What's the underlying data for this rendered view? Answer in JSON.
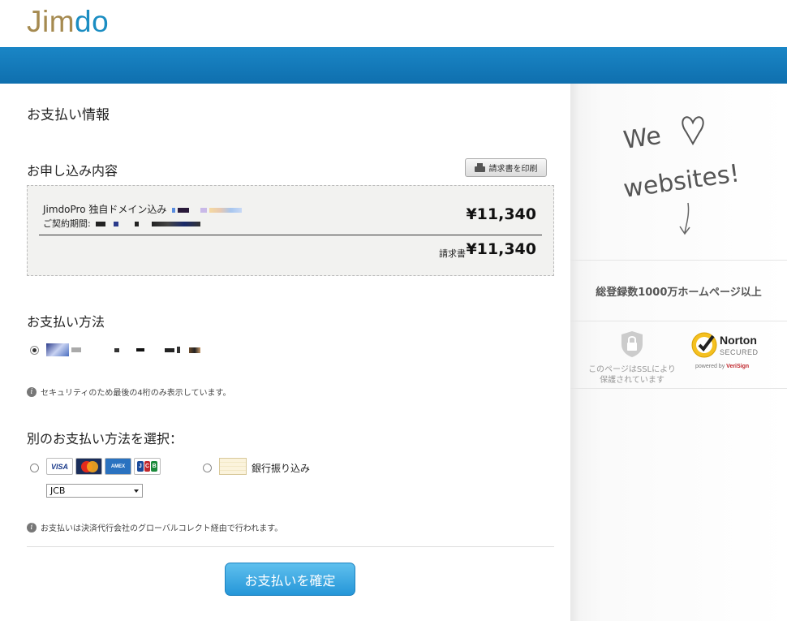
{
  "header": {
    "logo_part1": "Jim",
    "logo_part2": "do"
  },
  "payment_info": {
    "title": "お支払い情報"
  },
  "order": {
    "section_title": "お申し込み内容",
    "print_button": "請求書を印刷",
    "item_name": "JimdoPro 独自ドメイン込み",
    "item_period_label": "ご契約期間:",
    "item_price": "¥11,340",
    "total_label": "請求書",
    "total_price": "¥11,340"
  },
  "payment_method": {
    "section_title": "お支払い方法",
    "security_note": "セキュリティのため最後の4桁のみ表示しています。"
  },
  "alt_payment": {
    "section_title": "別のお支払い方法を選択：",
    "cards": [
      "VISA",
      "MasterCard",
      "AMERICAN EXPRESS",
      "JCB"
    ],
    "selected_card": "JCB",
    "bank_transfer_label": "銀行振り込み",
    "note": "お支払いは決済代行会社のグローバルコレクト経由で行われます。"
  },
  "confirm_button": "お支払いを確定",
  "sidebar": {
    "tagline_line1": "We",
    "tagline_line2": "websites!",
    "stat": "総登録数1000万ホームページ以上",
    "ssl_text_line1": "このページはSSLにより",
    "ssl_text_line2": "保護されています",
    "norton_name": "Norton",
    "norton_secured": "SECURED",
    "norton_powered": "powered by",
    "norton_verisign": "VeriSign"
  },
  "colors": {
    "brand_blue": "#1b8dc2",
    "brand_gold": "#a58a50",
    "button_blue": "#2596d8"
  }
}
